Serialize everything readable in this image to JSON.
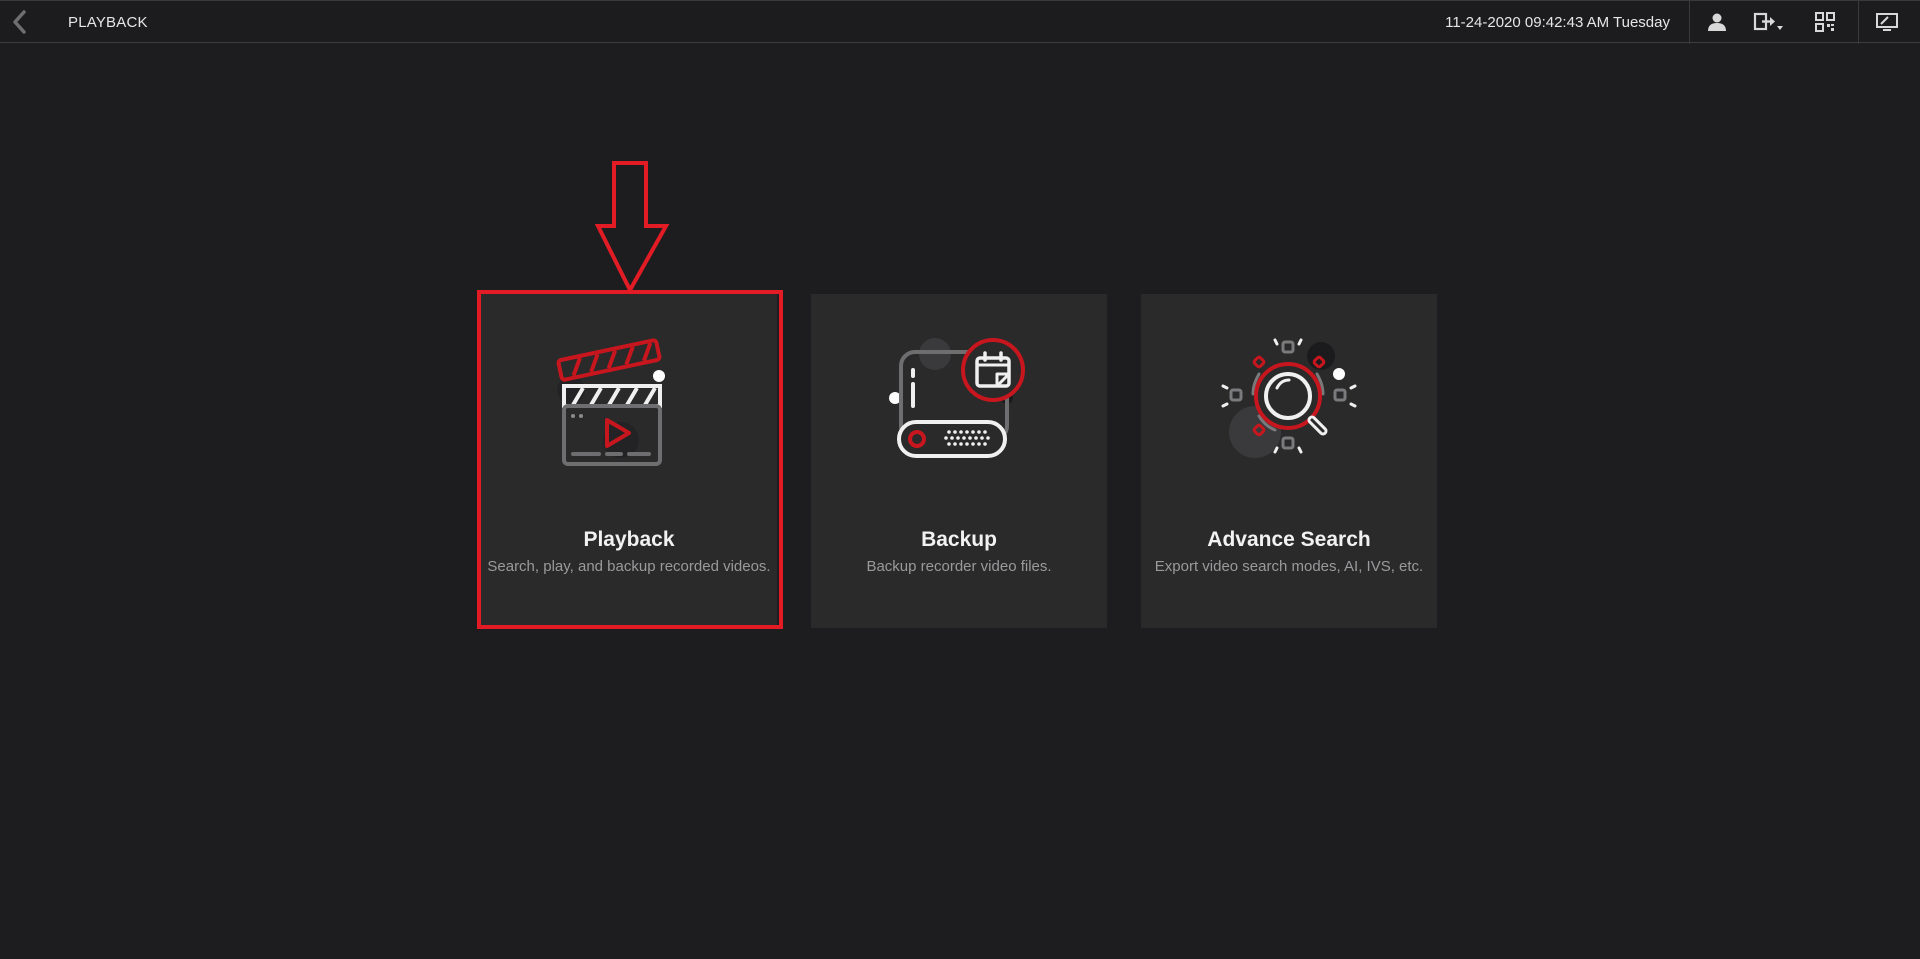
{
  "header": {
    "title": "PLAYBACK",
    "datetime": "11-24-2020 09:42:43 AM Tuesday",
    "icons": [
      "back-chevron-icon",
      "user-icon",
      "logout-icon",
      "qr-code-icon",
      "display-icon"
    ]
  },
  "cards": [
    {
      "title": "Playback",
      "description": "Search, play, and backup recorded videos.",
      "icon": "clapperboard-icon"
    },
    {
      "title": "Backup",
      "description": "Backup recorder video files.",
      "icon": "recorder-calendar-icon"
    },
    {
      "title": "Advance Search",
      "description": "Export video search modes, AI, IVS, etc.",
      "icon": "magnifier-icon"
    }
  ],
  "annotation": {
    "color": "#e21b24",
    "target": "Playback"
  },
  "colors": {
    "background": "#1d1d1f",
    "card": "#2a2a2b",
    "accent": "#c8161e"
  }
}
